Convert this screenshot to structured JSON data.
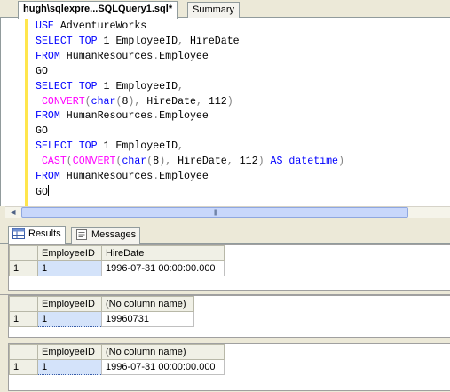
{
  "tabs": [
    {
      "label": "hugh\\sqlexpre...SQLQuery1.sql*"
    },
    {
      "label": "Summary"
    }
  ],
  "editor": {
    "lines": [
      [
        {
          "t": "USE ",
          "c": "kw"
        },
        {
          "t": "AdventureWorks",
          "c": ""
        }
      ],
      [
        {
          "t": "SELECT ",
          "c": "kw"
        },
        {
          "t": "TOP ",
          "c": "kw"
        },
        {
          "t": "1 EmployeeID",
          "c": ""
        },
        {
          "t": ", ",
          "c": "gr"
        },
        {
          "t": "HireDate",
          "c": ""
        }
      ],
      [
        {
          "t": "FROM ",
          "c": "kw"
        },
        {
          "t": "HumanResources",
          "c": ""
        },
        {
          "t": ".",
          "c": "gr"
        },
        {
          "t": "Employee",
          "c": ""
        }
      ],
      [
        {
          "t": "GO",
          "c": ""
        }
      ],
      [
        {
          "t": "SELECT ",
          "c": "kw"
        },
        {
          "t": "TOP ",
          "c": "kw"
        },
        {
          "t": "1 EmployeeID",
          "c": ""
        },
        {
          "t": ",",
          "c": "gr"
        }
      ],
      [
        {
          "t": " CONVERT",
          "c": "fn"
        },
        {
          "t": "(",
          "c": "gr"
        },
        {
          "t": "char",
          "c": "kw"
        },
        {
          "t": "(",
          "c": "gr"
        },
        {
          "t": "8",
          "c": ""
        },
        {
          "t": "), ",
          "c": "gr"
        },
        {
          "t": "HireDate",
          "c": ""
        },
        {
          "t": ", ",
          "c": "gr"
        },
        {
          "t": "112",
          "c": ""
        },
        {
          "t": ")",
          "c": "gr"
        }
      ],
      [
        {
          "t": "FROM ",
          "c": "kw"
        },
        {
          "t": "HumanResources",
          "c": ""
        },
        {
          "t": ".",
          "c": "gr"
        },
        {
          "t": "Employee",
          "c": ""
        }
      ],
      [
        {
          "t": "GO",
          "c": ""
        }
      ],
      [
        {
          "t": "SELECT ",
          "c": "kw"
        },
        {
          "t": "TOP ",
          "c": "kw"
        },
        {
          "t": "1 EmployeeID",
          "c": ""
        },
        {
          "t": ",",
          "c": "gr"
        }
      ],
      [
        {
          "t": " CAST",
          "c": "fn"
        },
        {
          "t": "(",
          "c": "gr"
        },
        {
          "t": "CONVERT",
          "c": "fn"
        },
        {
          "t": "(",
          "c": "gr"
        },
        {
          "t": "char",
          "c": "kw"
        },
        {
          "t": "(",
          "c": "gr"
        },
        {
          "t": "8",
          "c": ""
        },
        {
          "t": "), ",
          "c": "gr"
        },
        {
          "t": "HireDate",
          "c": ""
        },
        {
          "t": ", ",
          "c": "gr"
        },
        {
          "t": "112",
          "c": ""
        },
        {
          "t": ") ",
          "c": "gr"
        },
        {
          "t": "AS ",
          "c": "kw"
        },
        {
          "t": "datetime",
          "c": "kw"
        },
        {
          "t": ")",
          "c": "gr"
        }
      ],
      [
        {
          "t": "FROM ",
          "c": "kw"
        },
        {
          "t": "HumanResources",
          "c": ""
        },
        {
          "t": ".",
          "c": "gr"
        },
        {
          "t": "Employee",
          "c": ""
        }
      ],
      [
        {
          "t": "GO",
          "c": ""
        }
      ]
    ]
  },
  "result_tabs": {
    "results_label": "Results",
    "messages_label": "Messages"
  },
  "grids": [
    {
      "columns": [
        "EmployeeID",
        "HireDate"
      ],
      "rows": [
        {
          "num": "1",
          "cells": [
            "1",
            "1996-07-31 00:00:00.000"
          ]
        }
      ]
    },
    {
      "columns": [
        "EmployeeID",
        "(No column name)"
      ],
      "rows": [
        {
          "num": "1",
          "cells": [
            "1",
            "19960731"
          ]
        }
      ]
    },
    {
      "columns": [
        "EmployeeID",
        "(No column name)"
      ],
      "rows": [
        {
          "num": "1",
          "cells": [
            "1",
            "1996-07-31 00:00:00.000"
          ]
        }
      ]
    }
  ],
  "colors": {
    "keyword": "#0000ff",
    "function": "#ff00ff",
    "operator": "#808080",
    "change_margin": "#ffe64d"
  }
}
